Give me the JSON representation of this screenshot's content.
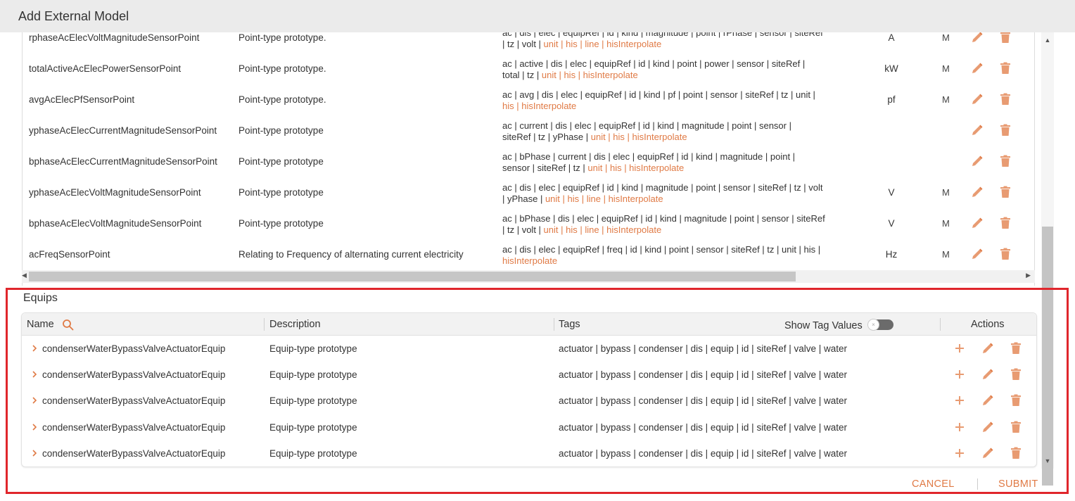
{
  "window": {
    "title": "Add External Model"
  },
  "colors": {
    "accent": "#e07a45",
    "highlight_border": "#e0262c",
    "header_bg": "#ebebeb"
  },
  "points": {
    "rows": [
      {
        "name": "rphaseAcElecVoltMagnitudeSensorPoint",
        "description": "Point-type prototype.",
        "tags_line1": "ac | dis | elec | equipRef | id | kind | magnitude | point | rPhase | sensor | siteRef",
        "tags_line2_plain": "| tz | volt | ",
        "tags_line2_hl": "unit | his | line | hisInterpolate",
        "tags_line2_tail": "",
        "unit": "A",
        "extra": "M"
      },
      {
        "name": "totalActiveAcElecPowerSensorPoint",
        "description": "Point-type prototype.",
        "tags_line1": "ac | active | dis | elec | equipRef | id | kind | point | power | sensor | siteRef |",
        "tags_line2_plain": "total | tz | ",
        "tags_line2_hl": "unit | his | hisInterpolate",
        "tags_line2_tail": "",
        "unit": "kW",
        "extra": "M"
      },
      {
        "name": "avgAcElecPfSensorPoint",
        "description": "Point-type prototype.",
        "tags_line1": "ac | avg | dis | elec | equipRef | id | kind | pf | point | sensor | siteRef | tz | unit |",
        "tags_line2_plain": "",
        "tags_line2_hl": "his | hisInterpolate",
        "tags_line2_tail": "",
        "unit": "pf",
        "extra": "M"
      },
      {
        "name": "yphaseAcElecCurrentMagnitudeSensorPoint",
        "description": "Point-type prototype",
        "tags_line1": "ac | current | dis | elec | equipRef | id | kind | magnitude | point | sensor |",
        "tags_line2_plain": "siteRef | tz | yPhase | ",
        "tags_line2_hl": "unit | his | hisInterpolate",
        "tags_line2_tail": "",
        "unit": "",
        "extra": ""
      },
      {
        "name": "bphaseAcElecCurrentMagnitudeSensorPoint",
        "description": "Point-type prototype",
        "tags_line1": "ac | bPhase | current | dis | elec | equipRef | id | kind | magnitude | point |",
        "tags_line2_plain": "sensor | siteRef | tz | ",
        "tags_line2_hl": "unit | his | hisInterpolate",
        "tags_line2_tail": "",
        "unit": "",
        "extra": ""
      },
      {
        "name": "yphaseAcElecVoltMagnitudeSensorPoint",
        "description": "Point-type prototype",
        "tags_line1": "ac | dis | elec | equipRef | id | kind | magnitude | point | sensor | siteRef | tz | volt",
        "tags_line2_plain": "| yPhase | ",
        "tags_line2_hl": "unit | his | line | hisInterpolate",
        "tags_line2_tail": "",
        "unit": "V",
        "extra": "M"
      },
      {
        "name": "bphaseAcElecVoltMagnitudeSensorPoint",
        "description": "Point-type prototype",
        "tags_line1": "ac | bPhase | dis | elec | equipRef | id | kind | magnitude | point | sensor | siteRef",
        "tags_line2_plain": "| tz | volt | ",
        "tags_line2_hl": "unit | his | line | hisInterpolate",
        "tags_line2_tail": "",
        "unit": "V",
        "extra": "M"
      },
      {
        "name": "acFreqSensorPoint",
        "description": "Relating to Frequency of alternating current electricity",
        "tags_line1": "ac | dis | elec | equipRef | freq | id | kind | point | sensor | siteRef | tz | unit | his |",
        "tags_line2_plain": "",
        "tags_line2_hl": "hisInterpolate",
        "tags_line2_tail": "",
        "unit": "Hz",
        "extra": "M"
      }
    ]
  },
  "equips": {
    "title": "Equips",
    "headers": {
      "name": "Name",
      "description": "Description",
      "tags": "Tags",
      "show_tag_values": "Show Tag Values",
      "actions": "Actions"
    },
    "show_tag_values_on": false,
    "rows": [
      {
        "name": "condenserWaterBypassValveActuatorEquip",
        "description": "Equip-type prototype",
        "tags": "actuator | bypass | condenser | dis | equip | id | siteRef | valve | water"
      },
      {
        "name": "condenserWaterBypassValveActuatorEquip",
        "description": "Equip-type prototype",
        "tags": "actuator | bypass | condenser | dis | equip | id | siteRef | valve | water"
      },
      {
        "name": "condenserWaterBypassValveActuatorEquip",
        "description": "Equip-type prototype",
        "tags": "actuator | bypass | condenser | dis | equip | id | siteRef | valve | water"
      },
      {
        "name": "condenserWaterBypassValveActuatorEquip",
        "description": "Equip-type prototype",
        "tags": "actuator | bypass | condenser | dis | equip | id | siteRef | valve | water"
      },
      {
        "name": "condenserWaterBypassValveActuatorEquip",
        "description": "Equip-type prototype",
        "tags": "actuator | bypass | condenser | dis | equip | id | siteRef | valve | water"
      }
    ]
  },
  "footer": {
    "cancel_label": "CANCEL",
    "submit_label": "SUBMIT"
  },
  "icons": {
    "edit": "pencil-icon",
    "delete": "trash-icon",
    "add": "plus-icon",
    "search": "search-icon",
    "expand": "chevron-right-icon"
  }
}
